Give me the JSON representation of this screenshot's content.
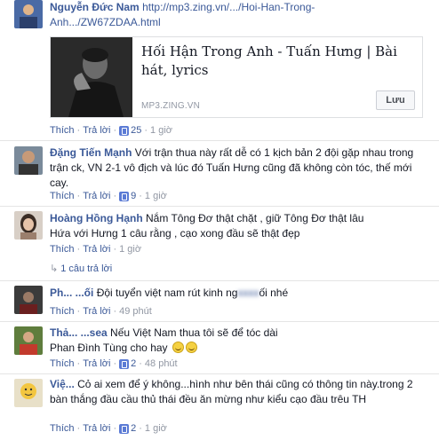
{
  "comments": [
    {
      "author": "Nguyễn Đức Nam",
      "text": "http://mp3.zing.vn/.../Hoi-Han-Trong-Anh.../ZW67ZDAA.html",
      "link_line1": "http://mp3.zing.vn/.../Hoi-Han-Trong-",
      "link_line2": "Anh.../ZW67ZDAA.html",
      "card": {
        "title": "Hối Hận Trong Anh - Tuấn Hưng | Bài hát, lyrics",
        "domain": "MP3.ZING.VN",
        "save_label": "Lưu"
      },
      "like": "Thích",
      "reply": "Trả lời",
      "likes": "25",
      "time": "1 giờ"
    },
    {
      "author": "Đặng Tiến Mạnh",
      "text": "Với trận thua này rất dễ có 1 kịch bản 2 đội gặp nhau trong trận ck, VN 2-1 vô địch và lúc đó Tuấn Hưng cũng đã không còn tóc, thế mới cay.",
      "like": "Thích",
      "reply": "Trả lời",
      "likes": "9",
      "time": "1 giờ"
    },
    {
      "author": "Hoàng Hồng Hạnh",
      "text": "Nắm Tông Đơ thật chặt , giữ Tông Đơ thật lâu Hứa với Hưng 1 câu rằng , cạo xong đầu sẽ thật đẹp",
      "line1": "Nắm Tông Đơ thật chặt , giữ Tông Đơ thật lâu",
      "line2": "Hứa với Hưng 1 câu rằng , cạo xong đầu sẽ thật đẹp",
      "like": "Thích",
      "reply": "Trả lời",
      "time": "1 giờ",
      "reply_count": "1 câu trả lời"
    },
    {
      "author": "Ph... ...ối",
      "text": "Đội tuyển việt nam rút kinh ng... ...ối nhé",
      "text_a": "Đội tuyển việt nam rút kinh ng",
      "text_b": "ối nhé",
      "like": "Thích",
      "reply": "Trả lời",
      "time": "49 phút"
    },
    {
      "author": "Thả... ...sea",
      "text": "Nếu Việt Nam thua tôi sẽ để tóc dài Phan Đình Tùng cho hay",
      "line1": "Nếu Việt Nam thua tôi sẽ để tóc dài",
      "line2": "Phan Đình Tùng cho hay",
      "like": "Thích",
      "reply": "Trả lời",
      "likes": "2",
      "time": "48 phút"
    },
    {
      "author": "Việ...",
      "text": "Cỏ ai xem để ý không...hình như bên thái cũng có thông tin này.trong 2 bàn thắng đầu cầu thủ thái đều ăn mừng như kiểu cạo đầu trêu TH",
      "like": "Thích",
      "reply": "Trả lời",
      "likes": "2",
      "time": "1 giờ"
    }
  ],
  "colors": {
    "link": "#3b5998",
    "meta": "#9197a3",
    "like_icon": "#5b7bd5"
  },
  "icons": [
    "like-icon",
    "reply-arrow-icon",
    "emoji-icon"
  ]
}
